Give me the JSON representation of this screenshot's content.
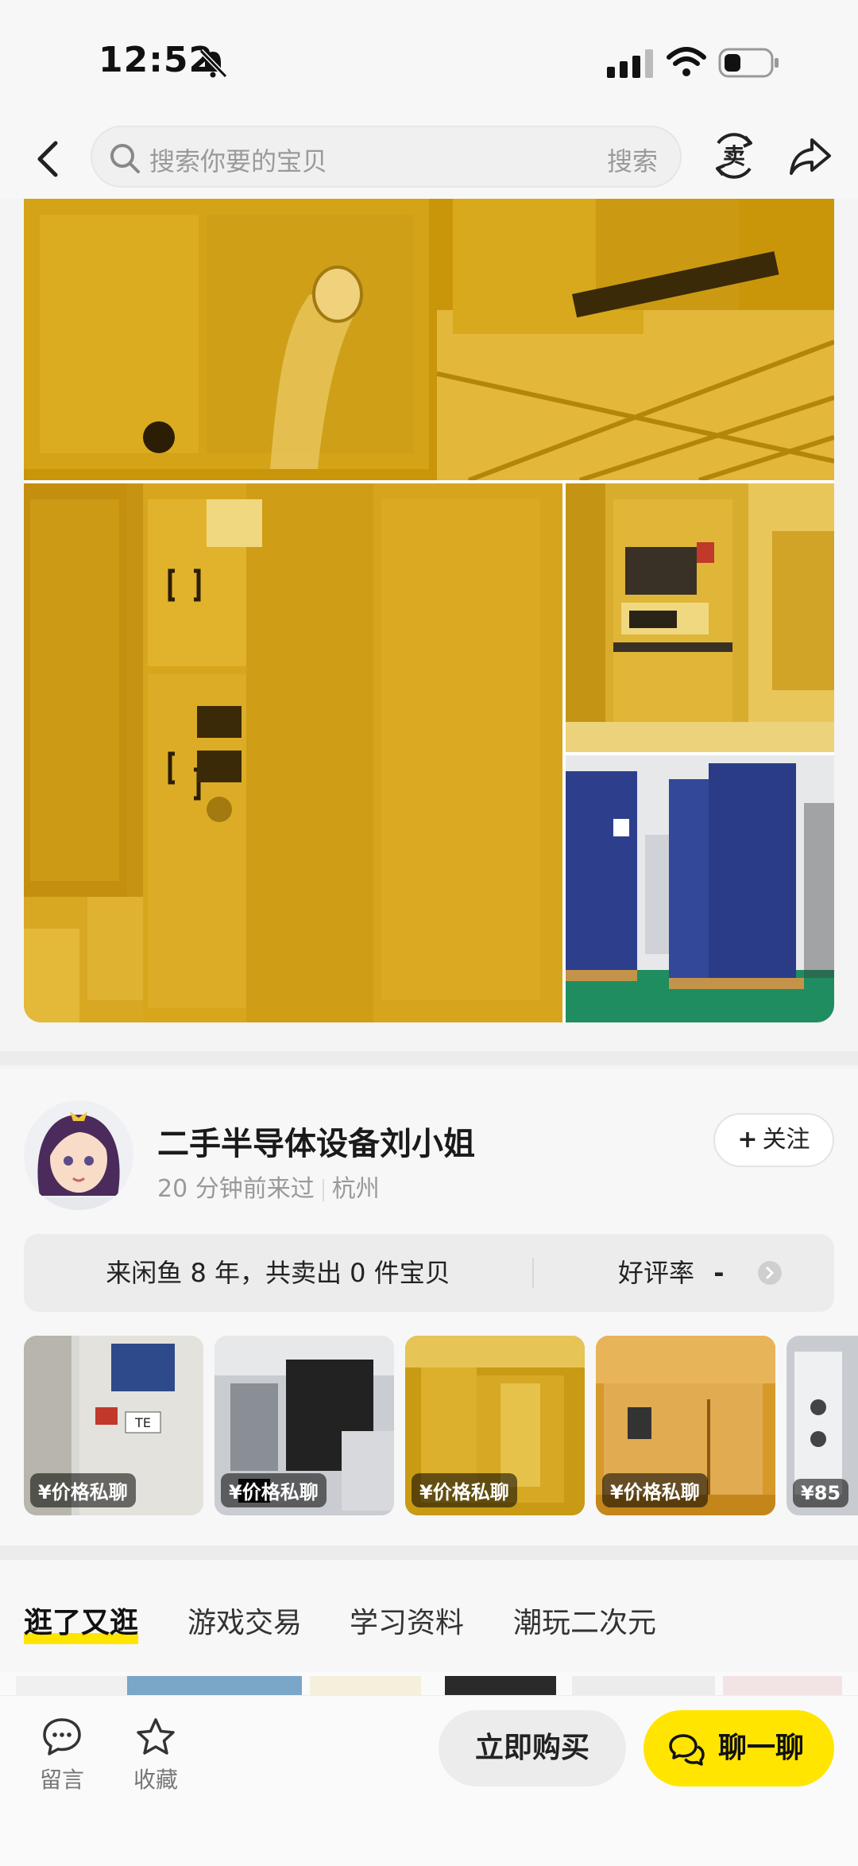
{
  "status_bar": {
    "time": "12:52"
  },
  "nav": {
    "search_placeholder": "搜索你要的宝贝",
    "search_button": "搜索",
    "sell_label": "卖"
  },
  "seller": {
    "name": "二手半导体设备刘小姐",
    "last_seen": "20 分钟前来过",
    "location": "杭州",
    "follow_label": "关注",
    "summary": "来闲鱼 8 年，共卖出 0 件宝贝",
    "rating_label": "好评率",
    "rating_value": "-"
  },
  "thumbnails": [
    {
      "price": "¥价格私聊",
      "label": "TE"
    },
    {
      "price": "¥价格私聊"
    },
    {
      "price": "¥价格私聊"
    },
    {
      "price": "¥价格私聊"
    },
    {
      "price": "¥85"
    }
  ],
  "tabs": [
    {
      "label": "逛了又逛",
      "active": true
    },
    {
      "label": "游戏交易",
      "active": false
    },
    {
      "label": "学习资料",
      "active": false
    },
    {
      "label": "潮玩二次元",
      "active": false
    }
  ],
  "bottom_bar": {
    "message_label": "留言",
    "favorite_label": "收藏",
    "buy_label": "立即购买",
    "chat_label": "聊一聊"
  },
  "colors": {
    "accent_yellow": "#ffe500",
    "cleanroom_yellow": "#d9a90a",
    "wrap_blue": "#2d3f8c"
  }
}
